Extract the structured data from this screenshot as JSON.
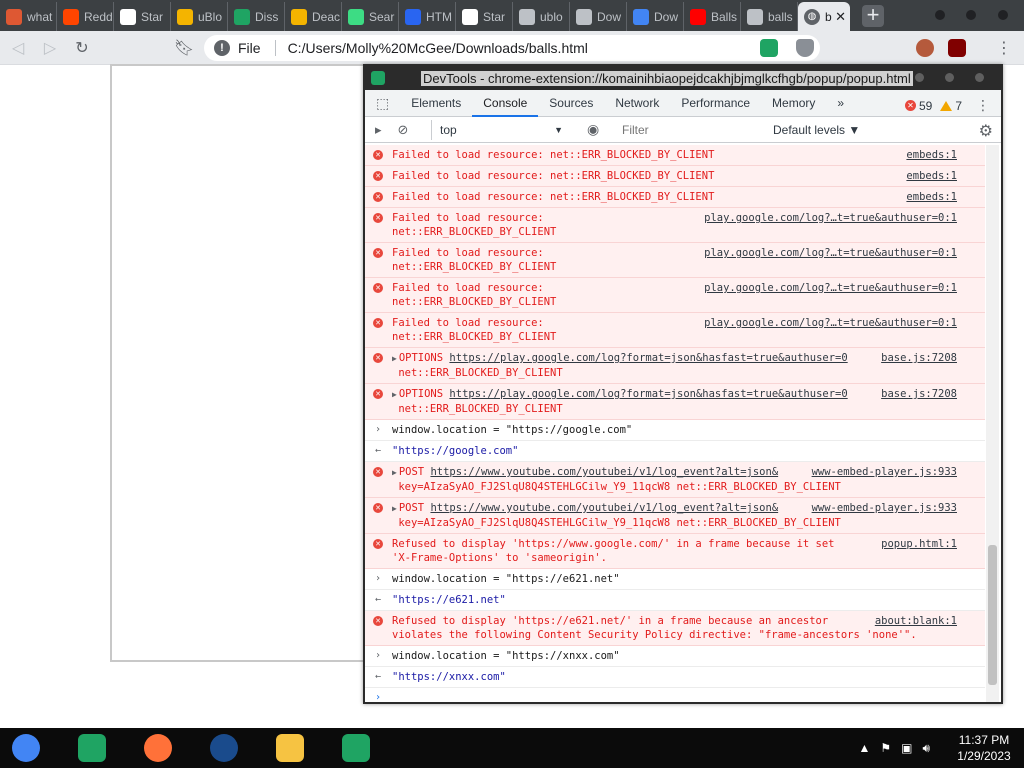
{
  "browser": {
    "tabs": [
      {
        "label": "what",
        "icon": "duckduckgo-icon",
        "color": "#de5833"
      },
      {
        "label": "Redd",
        "icon": "reddit-icon",
        "color": "#ff4500"
      },
      {
        "label": "Star",
        "icon": "search-icon",
        "color": "#ffffff"
      },
      {
        "label": "uBlo",
        "icon": "rainbow-icon",
        "color": "#f4b400"
      },
      {
        "label": "Diss",
        "icon": "docs-icon",
        "color": "#1fa463"
      },
      {
        "label": "Deac",
        "icon": "rainbow-icon",
        "color": "#f4b400"
      },
      {
        "label": "Sear",
        "icon": "g-icon",
        "color": "#3ddc84"
      },
      {
        "label": "HTM",
        "icon": "css-icon",
        "color": "#2965f1"
      },
      {
        "label": "Star",
        "icon": "search-icon",
        "color": "#ffffff"
      },
      {
        "label": "ublo",
        "icon": "github-icon",
        "color": "#bdc1c6"
      },
      {
        "label": "Dow",
        "icon": "github-icon",
        "color": "#bdc1c6"
      },
      {
        "label": "Dow",
        "icon": "download-icon",
        "color": "#4285f4"
      },
      {
        "label": "Balls",
        "icon": "youtube-icon",
        "color": "#ff0000"
      },
      {
        "label": "balls",
        "icon": "globe-icon",
        "color": "#bdc1c6"
      }
    ],
    "active_tab": {
      "label": "b",
      "close": "✕"
    },
    "new_tab": "+",
    "omnibox": {
      "scheme": "File",
      "url": "C:/Users/Molly%20McGee/Downloads/balls.html"
    }
  },
  "devtools": {
    "title": "DevTools - chrome-extension://komainihbiaopejdcakhjbjmglkcfhgb/popup/popup.html",
    "tabs": [
      "Elements",
      "Console",
      "Sources",
      "Network",
      "Performance",
      "Memory"
    ],
    "more": "»",
    "active_tab": "Console",
    "error_count": "59",
    "warning_count": "7",
    "context": "top",
    "filter_placeholder": "Filter",
    "levels": "Default levels ▼",
    "messages": [
      {
        "type": "err",
        "text": "Failed to load resource: net::ERR_BLOCKED_BY_CLIENT",
        "src": "embeds:1"
      },
      {
        "type": "err",
        "text": "Failed to load resource: net::ERR_BLOCKED_BY_CLIENT",
        "src": "embeds:1"
      },
      {
        "type": "err",
        "text": "Failed to load resource: net::ERR_BLOCKED_BY_CLIENT",
        "src": "embeds:1"
      },
      {
        "type": "err",
        "text": "Failed to load resource:\nnet::ERR_BLOCKED_BY_CLIENT",
        "src": "play.google.com/log?…t=true&authuser=0:1"
      },
      {
        "type": "err",
        "text": "Failed to load resource:\nnet::ERR_BLOCKED_BY_CLIENT",
        "src": "play.google.com/log?…t=true&authuser=0:1"
      },
      {
        "type": "err",
        "text": "Failed to load resource:\nnet::ERR_BLOCKED_BY_CLIENT",
        "src": "play.google.com/log?…t=true&authuser=0:1"
      },
      {
        "type": "err",
        "text": "Failed to load resource:\nnet::ERR_BLOCKED_BY_CLIENT",
        "src": "play.google.com/log?…t=true&authuser=0:1"
      },
      {
        "type": "err",
        "method": "OPTIONS",
        "link": "https://play.google.com/log?format=json&hasfast=true&authuser=0",
        "text2": "net::ERR_BLOCKED_BY_CLIENT",
        "src": "base.js:7208"
      },
      {
        "type": "err",
        "method": "OPTIONS",
        "link": "https://play.google.com/log?format=json&hasfast=true&authuser=0",
        "text2": "net::ERR_BLOCKED_BY_CLIENT",
        "src": "base.js:7208"
      },
      {
        "type": "inp",
        "text": "window.location = \"https://google.com\""
      },
      {
        "type": "out",
        "text": "\"https://google.com\""
      },
      {
        "type": "err",
        "method": "POST",
        "link": "https://www.youtube.com/youtubei/v1/log_event?alt=json&",
        "text2": "key=AIzaSyAO_FJ2SlqU8Q4STEHLGCilw_Y9_11qcW8 net::ERR_BLOCKED_BY_CLIENT",
        "src": "www-embed-player.js:933"
      },
      {
        "type": "err",
        "method": "POST",
        "link": "https://www.youtube.com/youtubei/v1/log_event?alt=json&",
        "text2": "key=AIzaSyAO_FJ2SlqU8Q4STEHLGCilw_Y9_11qcW8 net::ERR_BLOCKED_BY_CLIENT",
        "src": "www-embed-player.js:933"
      },
      {
        "type": "err",
        "text": "Refused to display 'https://www.google.com/' in a frame because it set\n'X-Frame-Options' to 'sameorigin'.",
        "src": "popup.html:1"
      },
      {
        "type": "inp",
        "text": "window.location = \"https://e621.net\""
      },
      {
        "type": "out",
        "text": "\"https://e621.net\""
      },
      {
        "type": "err",
        "text": "Refused to display 'https://e621.net/' in a frame because an ancestor\nviolates the following Content Security Policy directive: \"frame-ancestors 'none'\".",
        "src": "about:blank:1"
      },
      {
        "type": "inp",
        "text": "window.location = \"https://xnxx.com\""
      },
      {
        "type": "out",
        "text": "\"https://xnxx.com\""
      },
      {
        "type": "prompt",
        "text": ""
      }
    ]
  },
  "taskbar": {
    "apps": [
      {
        "name": "chrome",
        "color": "#4285f4"
      },
      {
        "name": "docs",
        "color": "#1fa463"
      },
      {
        "name": "firefox",
        "color": "#ff7139"
      },
      {
        "name": "obama",
        "color": "#1a4b8c"
      },
      {
        "name": "files",
        "color": "#f6c342"
      },
      {
        "name": "docs2",
        "color": "#1fa463"
      }
    ],
    "time": "11:37 PM",
    "date": "1/29/2023"
  },
  "colors": {
    "error_text": "#e21b1b",
    "error_bg": "#fff0f0",
    "accent": "#1a73e8"
  }
}
